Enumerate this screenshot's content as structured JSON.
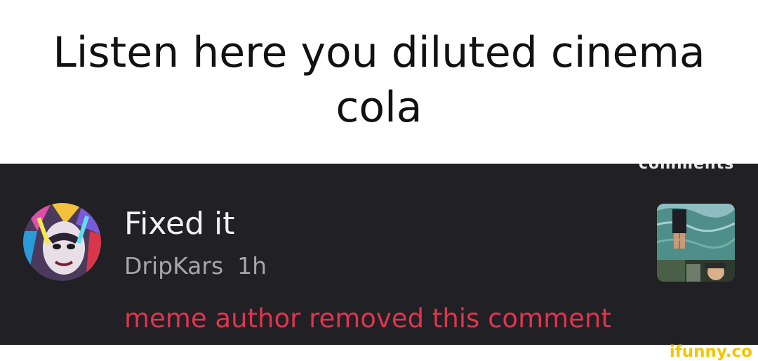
{
  "caption": {
    "text": "Listen here you diluted cinema cola"
  },
  "panel": {
    "header_fragment": "comments"
  },
  "comment": {
    "title": "Fixed it",
    "author": "DripKars",
    "time": "1h",
    "notice": "meme author removed this comment",
    "avatar_icon": "user-avatar-icon",
    "thumbnail_icon": "meme-thumbnail-icon"
  },
  "watermark": {
    "text": "ifunny.co"
  },
  "colors": {
    "caption_bg": "#ffffff",
    "panel_bg": "#212024",
    "title": "#f2f2f2",
    "meta": "#a6a6aa",
    "notice": "#e0344f",
    "watermark": "#f4c400"
  }
}
